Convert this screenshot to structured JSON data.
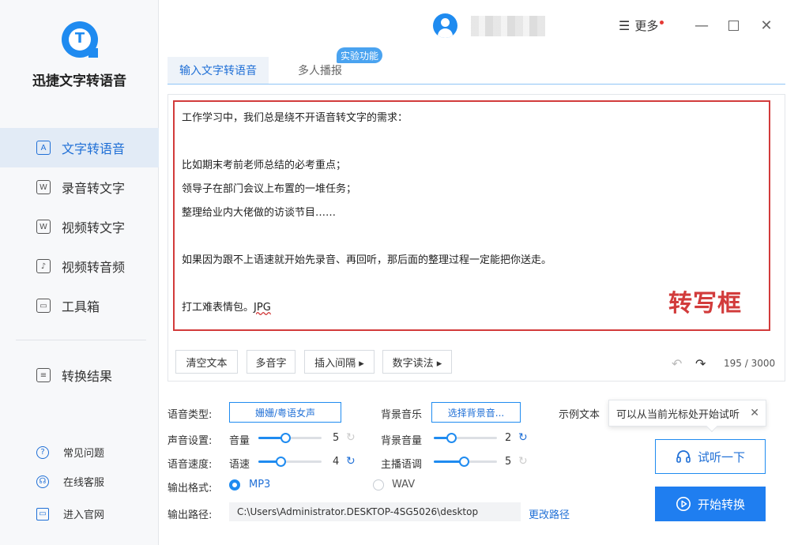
{
  "app": {
    "name": "迅捷文字转语音"
  },
  "sidebar": {
    "items": [
      {
        "label": "文字转语音",
        "icon": "text-to-speech-icon",
        "active": true
      },
      {
        "label": "录音转文字",
        "icon": "recording-to-text-icon"
      },
      {
        "label": "视频转文字",
        "icon": "video-to-text-icon"
      },
      {
        "label": "视频转音频",
        "icon": "video-to-audio-icon"
      },
      {
        "label": "工具箱",
        "icon": "toolbox-icon"
      }
    ],
    "result": {
      "label": "转换结果",
      "icon": "conversion-result-icon"
    },
    "footer": [
      {
        "label": "常见问题",
        "icon": "faq-icon"
      },
      {
        "label": "在线客服",
        "icon": "headset-icon"
      },
      {
        "label": "进入官网",
        "icon": "monitor-icon"
      }
    ]
  },
  "titlebar": {
    "more_label": "更多"
  },
  "tabs": [
    {
      "label": "输入文字转语音",
      "active": true
    },
    {
      "label": "多人播报"
    }
  ],
  "lab_badge": "实验功能",
  "editor": {
    "lines": [
      "工作学习中，我们总是绕不开语音转文字的需求：",
      "比如期末考前老师总结的必考重点；",
      "领导子在部门会议上布置的一堆任务；",
      "整理给业内大佬做的访谈节目……",
      "如果因为跟不上语速就开始先录音、再回听，那后面的整理过程一定能把你送走。",
      "打工难表情包。",
      "JPG"
    ],
    "overlay_label": "转写框"
  },
  "toolbar": {
    "clear": "清空文本",
    "polyphone": "多音字",
    "insert_pause": "插入间隔 ▸",
    "number_reading": "数字读法 ▸",
    "counter": "195 / 3000"
  },
  "settings": {
    "voice_type_label": "语音类型:",
    "voice_value": "姗姗/粤语女声",
    "bg_music_label": "背景音乐",
    "bg_music_button": "选择背景音...",
    "sample_text_label": "示例文本",
    "sound_label": "声音设置:",
    "volume_label": "音量",
    "volume_value": "5",
    "bg_volume_label": "背景音量",
    "bg_volume_value": "2",
    "speed_label": "语音速度:",
    "rate_label": "语速",
    "rate_value": "4",
    "pitch_label": "主播语调",
    "pitch_value": "5",
    "format_label": "输出格式:",
    "format_mp3": "MP3",
    "format_wav": "WAV",
    "selected_format": "MP3",
    "path_label": "输出路径:",
    "path_value": "C:\\Users\\Administrator.DESKTOP-4SG5026\\desktop",
    "change_path": "更改路径",
    "sliders": {
      "volume": 0.42,
      "bg_volume": 0.28,
      "rate": 0.35,
      "pitch": 0.48
    }
  },
  "tooltip": {
    "text": "可以从当前光标处开始试听"
  },
  "actions": {
    "listen": "试听一下",
    "start": "开始转换"
  },
  "colors": {
    "accent": "#1f8bf0",
    "highlight_red": "#d23b3b"
  }
}
